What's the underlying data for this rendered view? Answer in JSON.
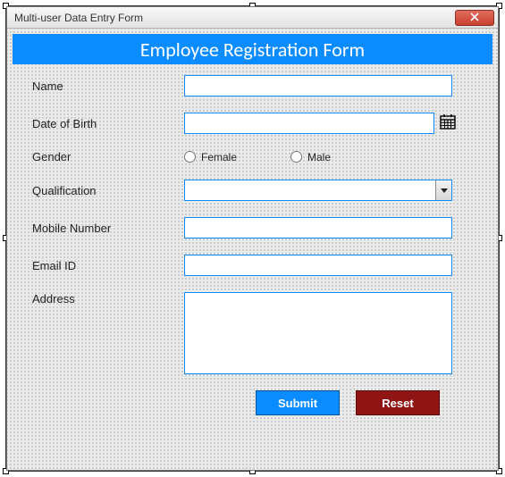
{
  "window": {
    "title": "Multi-user Data Entry Form"
  },
  "header": {
    "title": "Employee Registration Form"
  },
  "labels": {
    "name": "Name",
    "dob": "Date of Birth",
    "gender": "Gender",
    "qualification": "Qualification",
    "mobile": "Mobile Number",
    "email": "Email ID",
    "address": "Address"
  },
  "gender_options": {
    "female": "Female",
    "male": "Male"
  },
  "values": {
    "name": "",
    "dob": "",
    "qualification": "",
    "mobile": "",
    "email": "",
    "address": ""
  },
  "buttons": {
    "submit": "Submit",
    "reset": "Reset"
  },
  "colors": {
    "accent": "#0a8cff",
    "reset": "#8f1515"
  }
}
